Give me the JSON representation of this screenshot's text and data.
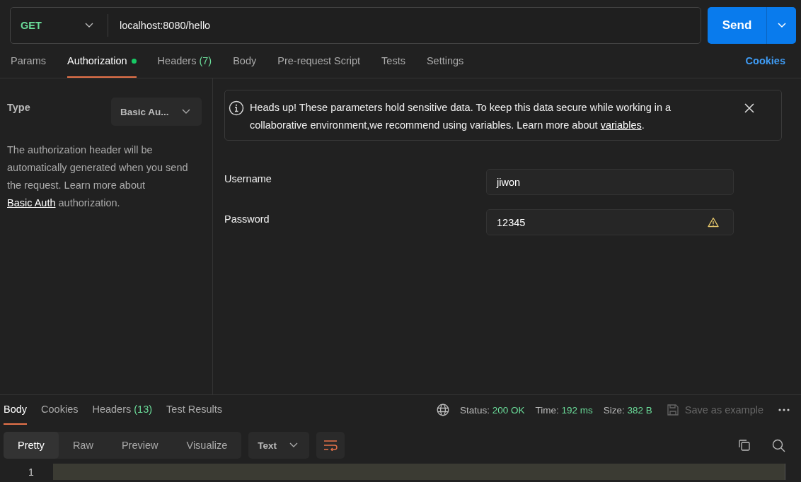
{
  "request": {
    "method": "GET",
    "url": "localhost:8080/hello",
    "send": "Send"
  },
  "request_tabs": [
    {
      "label": "Params",
      "selected": false,
      "dot": false
    },
    {
      "label": "Authorization",
      "selected": true,
      "dot": true
    },
    {
      "label": "Headers",
      "count": "(7)",
      "selected": false,
      "dot": false
    },
    {
      "label": "Body",
      "selected": false,
      "dot": false
    },
    {
      "label": "Pre-request Script",
      "selected": false,
      "dot": false
    },
    {
      "label": "Tests",
      "selected": false,
      "dot": false
    },
    {
      "label": "Settings",
      "selected": false,
      "dot": false
    }
  ],
  "cookies_link": "Cookies",
  "auth": {
    "type_label": "Type",
    "type_value": "Basic Au...",
    "description": "The authorization header will be automatically generated when you send the request. Learn more about",
    "link": "Basic Auth",
    "description_end": "authorization."
  },
  "notice": {
    "text": "Heads up! These parameters hold sensitive data. To keep this data secure while working in a collaborative environment,we recommend using variables. Learn more about",
    "link": "variables",
    "end": "."
  },
  "fields": [
    {
      "label": "Username",
      "value": "jiwon",
      "warning": false
    },
    {
      "label": "Password",
      "value": "12345",
      "warning": true
    }
  ],
  "response_tabs": [
    {
      "label": "Body",
      "selected": true
    },
    {
      "label": "Cookies",
      "selected": false
    },
    {
      "label": "Headers",
      "count": "(13)",
      "selected": false
    },
    {
      "label": "Test Results",
      "selected": false
    }
  ],
  "stats": [
    {
      "label": "Status:",
      "value": "200 OK"
    },
    {
      "label": "Time:",
      "value": "192 ms"
    },
    {
      "label": "Size:",
      "value": "382 B"
    }
  ],
  "save_example": {
    "label": "Save as example",
    "disabled": true
  },
  "view_tabs": [
    {
      "label": "Pretty",
      "selected": true
    },
    {
      "label": "Raw",
      "selected": false
    },
    {
      "label": "Preview",
      "selected": false
    },
    {
      "label": "Visualize",
      "selected": false
    }
  ],
  "format": "Text",
  "line_numbers": [
    "1"
  ]
}
